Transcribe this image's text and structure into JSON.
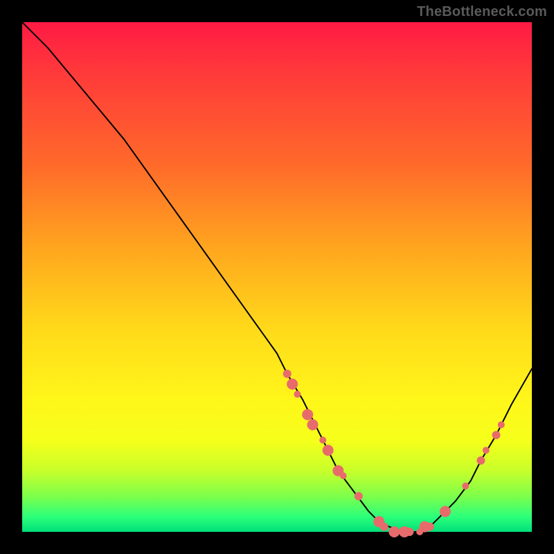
{
  "watermark": "TheBottleneck.com",
  "colors": {
    "frame_bg": "#000000",
    "dot": "#e86b6b",
    "curve": "#000000"
  },
  "chart_data": {
    "type": "line",
    "title": "",
    "xlabel": "",
    "ylabel": "",
    "xlim": [
      0,
      100
    ],
    "ylim": [
      0,
      100
    ],
    "x": [
      0,
      5,
      10,
      15,
      20,
      25,
      30,
      35,
      40,
      45,
      50,
      52,
      55,
      58,
      60,
      62,
      65,
      68,
      70,
      72,
      75,
      78,
      80,
      82,
      85,
      88,
      90,
      93,
      96,
      100
    ],
    "y": [
      100,
      95,
      89,
      83,
      77,
      70,
      63,
      56,
      49,
      42,
      35,
      31,
      26,
      20,
      16,
      12,
      8,
      4,
      2,
      1,
      0,
      0,
      1,
      3,
      6,
      10,
      14,
      19,
      25,
      32
    ],
    "annotations": [
      {
        "x": 52,
        "y": 31,
        "size": "md"
      },
      {
        "x": 53,
        "y": 29,
        "size": "lg"
      },
      {
        "x": 54,
        "y": 27,
        "size": "sm"
      },
      {
        "x": 56,
        "y": 23,
        "size": "lg"
      },
      {
        "x": 57,
        "y": 21,
        "size": "lg"
      },
      {
        "x": 59,
        "y": 18,
        "size": "sm"
      },
      {
        "x": 60,
        "y": 16,
        "size": "lg"
      },
      {
        "x": 62,
        "y": 12,
        "size": "lg"
      },
      {
        "x": 63,
        "y": 11,
        "size": "sm"
      },
      {
        "x": 66,
        "y": 7,
        "size": "md"
      },
      {
        "x": 70,
        "y": 2,
        "size": "lg"
      },
      {
        "x": 71,
        "y": 1,
        "size": "md"
      },
      {
        "x": 73,
        "y": 0,
        "size": "lg"
      },
      {
        "x": 75,
        "y": 0,
        "size": "lg"
      },
      {
        "x": 76,
        "y": 0,
        "size": "md"
      },
      {
        "x": 78,
        "y": 0,
        "size": "sm"
      },
      {
        "x": 79,
        "y": 1,
        "size": "lg"
      },
      {
        "x": 80,
        "y": 1,
        "size": "md"
      },
      {
        "x": 83,
        "y": 4,
        "size": "lg"
      },
      {
        "x": 87,
        "y": 9,
        "size": "sm"
      },
      {
        "x": 90,
        "y": 14,
        "size": "md"
      },
      {
        "x": 91,
        "y": 16,
        "size": "sm"
      },
      {
        "x": 93,
        "y": 19,
        "size": "md"
      },
      {
        "x": 94,
        "y": 21,
        "size": "sm"
      }
    ]
  }
}
